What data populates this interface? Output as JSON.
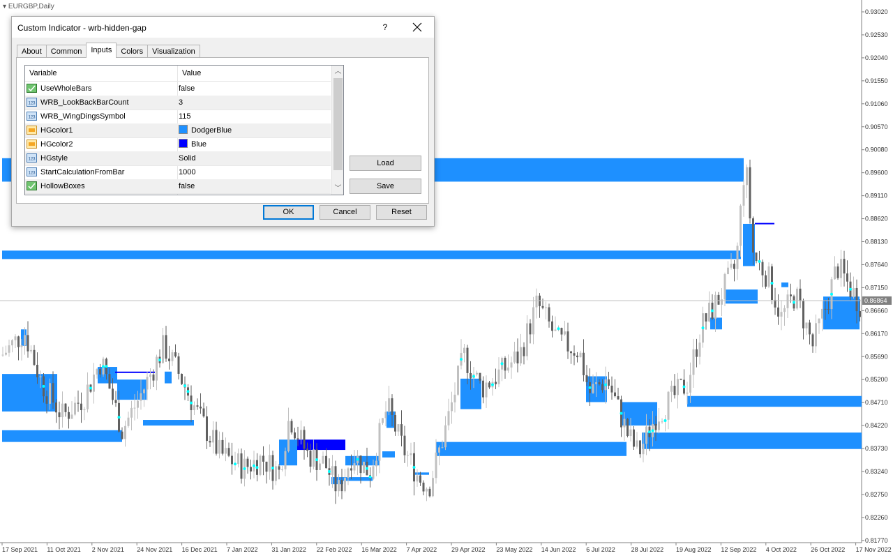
{
  "chart": {
    "symbol_title": "EURGBP,Daily",
    "current_price": "0.86864",
    "price_levels": [
      "0.93020",
      "0.92530",
      "0.92040",
      "0.91550",
      "0.91060",
      "0.90570",
      "0.90080",
      "0.89600",
      "0.89110",
      "0.88620",
      "0.88130",
      "0.87640",
      "0.87150",
      "0.86660",
      "0.86170",
      "0.85690",
      "0.85200",
      "0.84710",
      "0.84220",
      "0.83730",
      "0.83240",
      "0.82750",
      "0.82260",
      "0.81770"
    ],
    "dates": [
      "17 Sep 2021",
      "11 Oct 2021",
      "2 Nov 2021",
      "24 Nov 2021",
      "16 Dec 2021",
      "7 Jan 2022",
      "31 Jan 2022",
      "22 Feb 2022",
      "16 Mar 2022",
      "7 Apr 2022",
      "29 Apr 2022",
      "23 May 2022",
      "14 Jun 2022",
      "6 Jul 2022",
      "28 Jul 2022",
      "19 Aug 2022",
      "12 Sep 2022",
      "4 Oct 2022",
      "26 Oct 2022",
      "17 Nov 2022"
    ],
    "colors": {
      "hg_color1": "#1e90ff",
      "hg_color2": "#0000ff",
      "bull_candle": "#c0c0c0",
      "bear_candle": "#606060",
      "wing_symbol": "#00ffff"
    }
  },
  "dialog": {
    "title": "Custom Indicator - wrb-hidden-gap",
    "help_label": "?",
    "tabs": [
      {
        "label": "About"
      },
      {
        "label": "Common"
      },
      {
        "label": "Inputs"
      },
      {
        "label": "Colors"
      },
      {
        "label": "Visualization"
      }
    ],
    "active_tab": "Inputs",
    "grid": {
      "col_variable": "Variable",
      "col_value": "Value",
      "rows": [
        {
          "name": "UseWholeBars",
          "value": "false",
          "type_icon": "bool-icon"
        },
        {
          "name": "WRB_LookBackBarCount",
          "value": "3",
          "type_icon": "int-icon"
        },
        {
          "name": "WRB_WingDingsSymbol",
          "value": "115",
          "type_icon": "int-icon"
        },
        {
          "name": "HGcolor1",
          "value": "DodgerBlue",
          "type_icon": "color-icon",
          "swatch": "#1e90ff"
        },
        {
          "name": "HGcolor2",
          "value": "Blue",
          "type_icon": "color-icon",
          "swatch": "#0000ff"
        },
        {
          "name": "HGstyle",
          "value": "Solid",
          "type_icon": "int-icon"
        },
        {
          "name": "StartCalculationFromBar",
          "value": "1000",
          "type_icon": "int-icon"
        },
        {
          "name": "HollowBoxes",
          "value": "false",
          "type_icon": "bool-icon"
        }
      ]
    },
    "buttons": {
      "load": "Load",
      "save": "Save",
      "ok": "OK",
      "cancel": "Cancel",
      "reset": "Reset"
    }
  }
}
